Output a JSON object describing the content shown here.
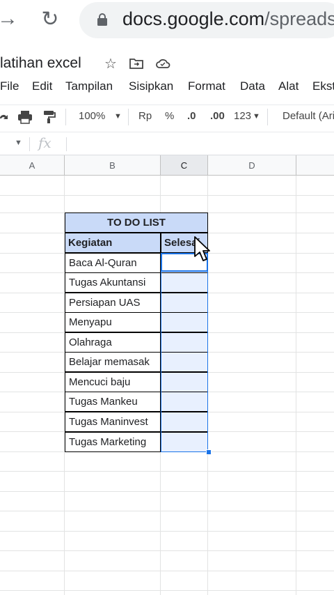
{
  "browser": {
    "url_main": "docs.google.com",
    "url_rest": "/spreadsh"
  },
  "doc": {
    "title": "latihan excel"
  },
  "menu": [
    "File",
    "Edit",
    "Tampilan",
    "Sisipkan",
    "Format",
    "Data",
    "Alat",
    "Ekst"
  ],
  "toolbar": {
    "zoom": "100%",
    "currency": "Rp",
    "percent": "%",
    "dec_decrease": ".0",
    "dec_increase": ".00",
    "number_format": "123",
    "font": "Default (Ari"
  },
  "formula": {
    "fx_label": "fx"
  },
  "columns": [
    "A",
    "B",
    "C",
    "D"
  ],
  "table": {
    "title": "TO DO LIST",
    "header_task": "Kegiatan",
    "header_status": "Selesai",
    "tasks": [
      "Baca Al-Quran",
      "Tugas Akuntansi",
      "Persiapan UAS",
      "Menyapu",
      "Olahraga",
      "Belajar memasak",
      "Mencuci baju",
      "Tugas Mankeu",
      "Tugas Maninvest",
      "Tugas Marketing"
    ]
  }
}
